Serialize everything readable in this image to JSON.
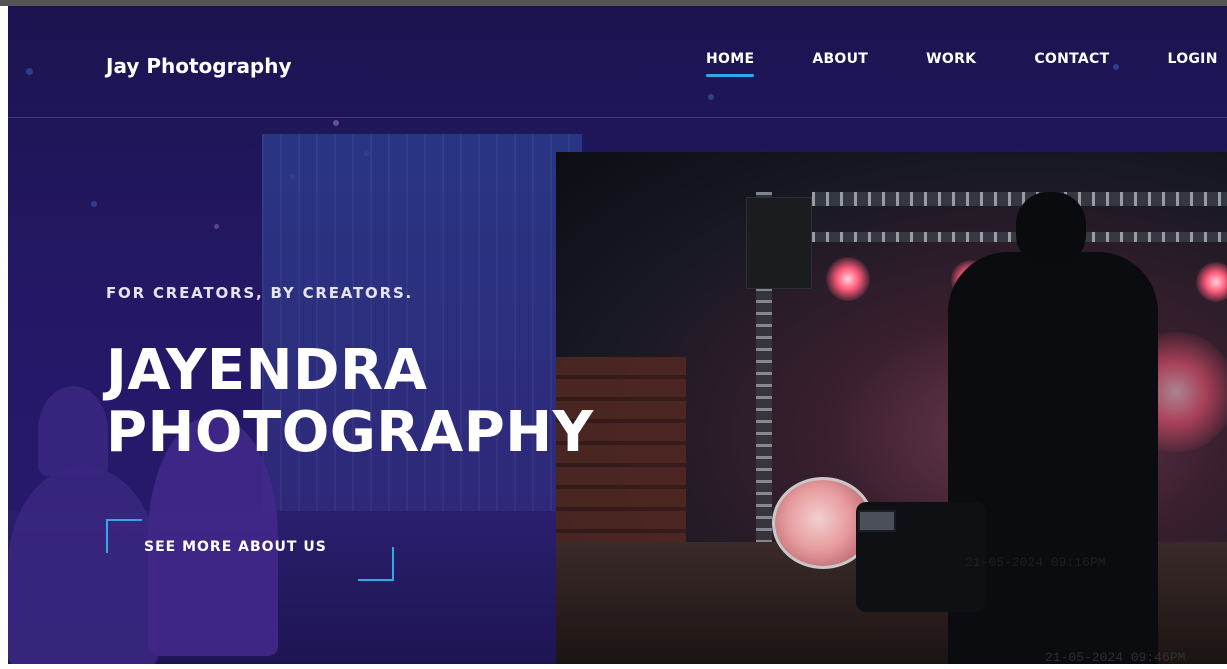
{
  "header": {
    "brand": "Jay Photography",
    "nav": [
      {
        "label": "HOME",
        "active": true
      },
      {
        "label": "ABOUT",
        "active": false
      },
      {
        "label": "WORK",
        "active": false
      },
      {
        "label": "CONTACT",
        "active": false
      },
      {
        "label": "LOGIN",
        "active": false
      }
    ]
  },
  "hero": {
    "tagline": "FOR CREATORS, BY CREATORS.",
    "title_line1": "JAYENDRA",
    "title_line2": "PHOTOGRAPHY",
    "cta_label": "SEE MORE ABOUT US"
  },
  "overlay": {
    "timestamp_1": "21-05-2024 09:16PM",
    "timestamp_2": "21-05-2024 09:46PM"
  },
  "colors": {
    "background": "#1b1450",
    "accent": "#2fa9e8",
    "text": "#ffffff"
  }
}
